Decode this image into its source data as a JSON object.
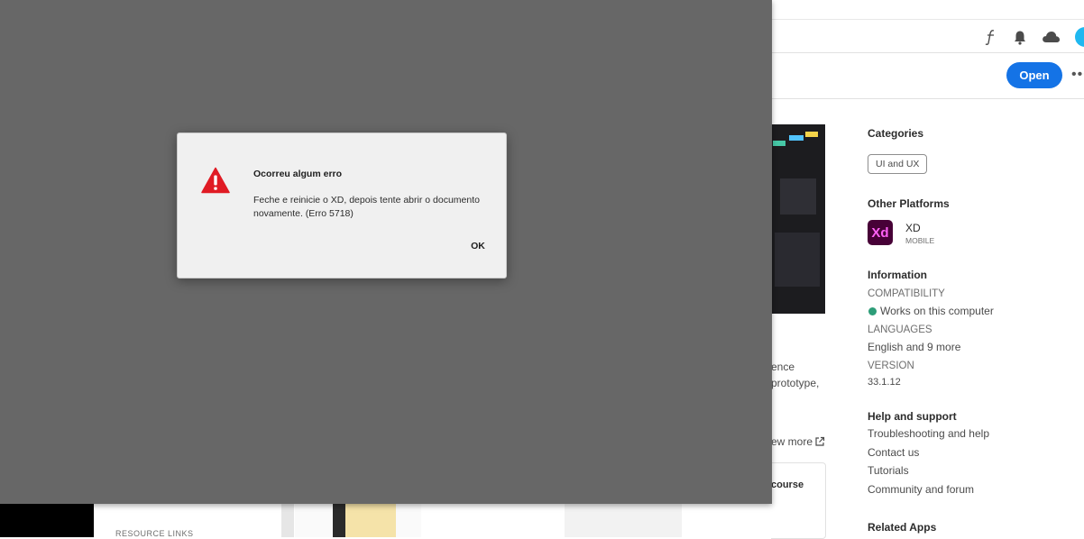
{
  "header": {
    "icons": [
      "script-f-icon",
      "bell-icon",
      "cloud-icon",
      "avatar"
    ]
  },
  "actions": {
    "open_label": "Open",
    "more_label": "•••"
  },
  "sidebar": {
    "categories_heading": "Categories",
    "category_chip": "UI and UX",
    "other_platforms_heading": "Other Platforms",
    "platform_name": "XD",
    "platform_type": "MOBILE",
    "platform_logo_text": "Xd",
    "information_heading": "Information",
    "compatibility_label": "COMPATIBILITY",
    "compatibility_value": "Works on this computer",
    "languages_label": "LANGUAGES",
    "languages_value": "English and 9 more",
    "version_label": "VERSION",
    "version_value": "33.1.12",
    "help_heading": "Help and support",
    "help_links": [
      "Troubleshooting and help",
      "Contact us",
      "Tutorials",
      "Community and forum"
    ],
    "related_heading": "Related Apps"
  },
  "main": {
    "snippet_1": "ence",
    "snippet_2": "prototype,",
    "view_more": "ew more",
    "course_text": "course",
    "resource_links": "RESOURCE LINKS"
  },
  "dialog": {
    "title": "Ocorreu algum erro",
    "message": "Feche e reinicie o XD, depois tente abrir o documento novamente. (Erro 5718)",
    "ok_label": "OK",
    "icon": "warning-icon"
  },
  "colors": {
    "accent": "#1473e6",
    "warning": "#e01b24",
    "overlay": "#676767",
    "success": "#2d9d78"
  }
}
